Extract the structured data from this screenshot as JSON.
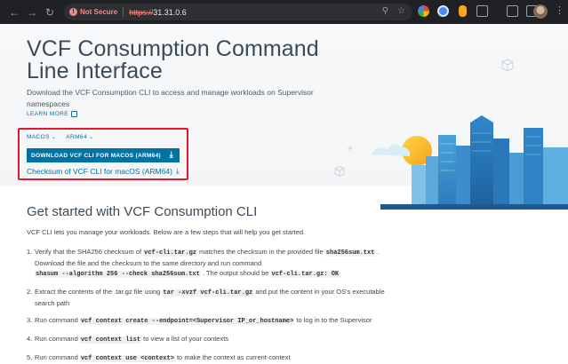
{
  "browser": {
    "not_secure_label": "Not Secure",
    "url_scheme": "https://",
    "url_host": "31.31.0.6"
  },
  "hero": {
    "title": "VCF Consumption Command Line Interface",
    "description": "Download the VCF Consumption CLI to access and manage workloads on Supervisor namespaces",
    "learn_more": "LEARN MORE",
    "os_select": "MACOS",
    "arch_select": "ARM64",
    "download_button": "DOWNLOAD VCF CLI FOR MACOS (ARM64)",
    "checksum_link": "Checksum of VCF CLI for macOS (ARM64)"
  },
  "get_started": {
    "heading": "Get started with VCF Consumption CLI",
    "intro": "VCF CLI lets you manage your workloads. Below are a few steps that will help you get started.",
    "steps": [
      {
        "num": "1.",
        "t1": "Verify that the SHA256 checksum of ",
        "c1": "vcf-cli.tar.gz",
        "t2": " matches the checksum in the provided file ",
        "c2": "sha256sum.txt",
        "t3": " .",
        "t4": "Download the file and the checksum to the same directory and run command",
        "c3": "shasum --algorithm 256 --check sha256sum.txt",
        "t5": " . The output should be ",
        "c4": "vcf-cli.tar.gz: OK"
      },
      {
        "num": "2.",
        "t1": "Extract the contents of the .tar.gz file using ",
        "c1": "tar -xvzf vcf-cli.tar.gz",
        "t2": " and put the content in your OS's executable",
        "t3": "search path"
      },
      {
        "num": "3.",
        "t1": "Run command ",
        "c1": "vcf context create --endpoint=<Supervisor IP_or_hostname>",
        "t2": " to log in to the Supervisor"
      },
      {
        "num": "4.",
        "t1": "Run command ",
        "c1": "vcf context list",
        "t2": " to view a list of your contexts"
      },
      {
        "num": "5.",
        "t1": "Run command ",
        "c1": "vcf context use <context>",
        "t2": " to make the context as current-context"
      }
    ]
  }
}
